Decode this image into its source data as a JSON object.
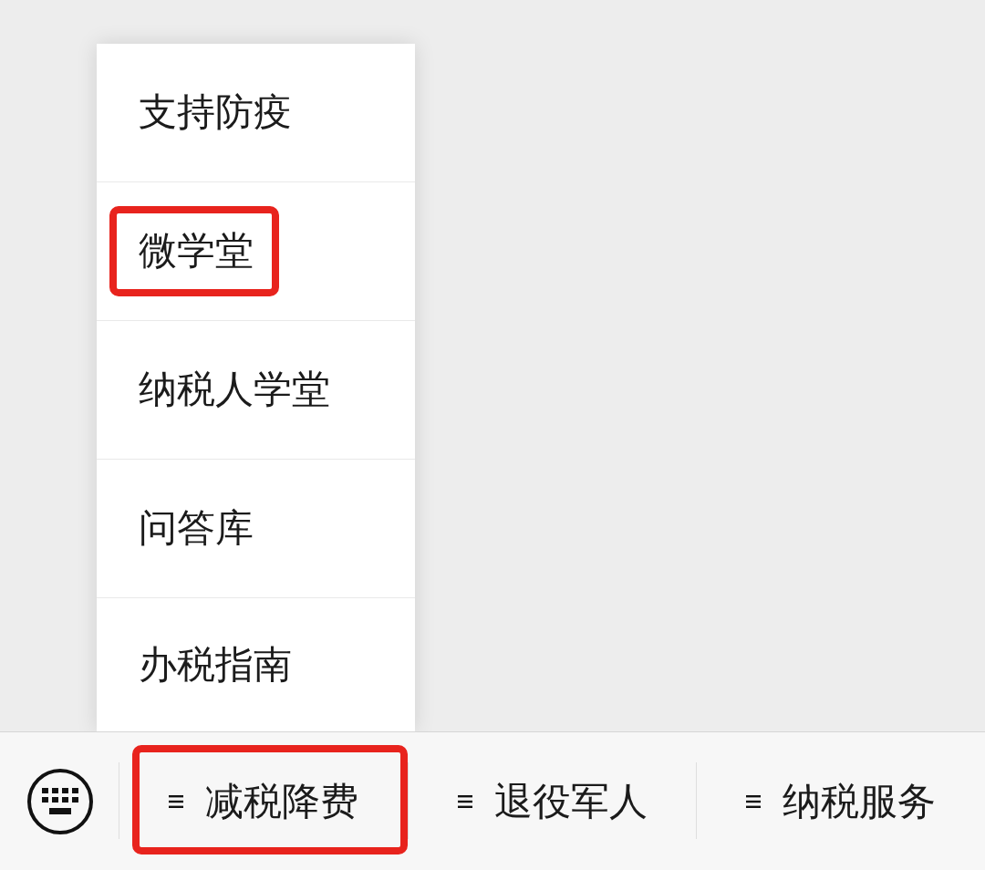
{
  "menu_popup": {
    "items": [
      {
        "label": "支持防疫",
        "highlighted": false
      },
      {
        "label": "微学堂",
        "highlighted": true
      },
      {
        "label": "纳税人学堂",
        "highlighted": false
      },
      {
        "label": "问答库",
        "highlighted": false
      },
      {
        "label": "办税指南",
        "highlighted": false
      }
    ]
  },
  "menu_bar": {
    "items": [
      {
        "label": "减税降费",
        "highlighted": true
      },
      {
        "label": "退役军人",
        "highlighted": false
      },
      {
        "label": "纳税服务",
        "highlighted": false
      }
    ]
  }
}
